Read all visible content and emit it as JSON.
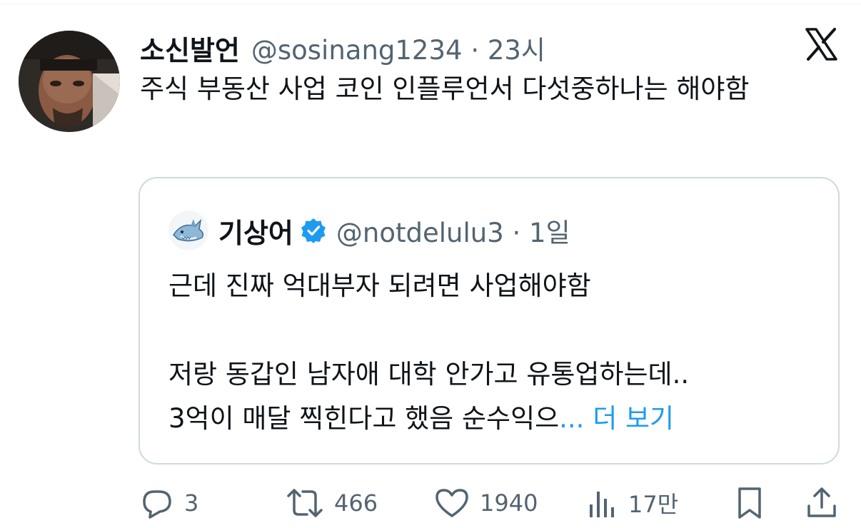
{
  "tweet": {
    "display_name": "소신발언",
    "handle": "@sosinang1234",
    "separator": "·",
    "time": "23시",
    "text": "주식 부동산 사업 코인 인플루언서 다섯중하나는 해야함"
  },
  "quoted_tweet": {
    "display_name": "기상어",
    "handle": "@notdelulu3",
    "separator": "·",
    "time": "1일",
    "line1": "근데 진짜 억대부자 되려면 사업해야함",
    "line2": "저랑 동갑인 남자애 대학 안가고 유통업하는데..",
    "line3": "3억이 매달 찍힌다고 했음 순수익으",
    "ellipsis": "...",
    "show_more": "더 보기"
  },
  "actions": {
    "replies": "3",
    "retweets": "466",
    "likes": "1940",
    "views": "17만"
  },
  "colors": {
    "text": "#0f1419",
    "secondary": "#536471",
    "accent": "#1d9bf0",
    "border": "#cfd9de"
  },
  "icons": [
    "x-logo-icon",
    "verified-badge-icon",
    "reply-icon",
    "retweet-icon",
    "like-icon",
    "views-icon",
    "bookmark-icon",
    "share-icon"
  ]
}
